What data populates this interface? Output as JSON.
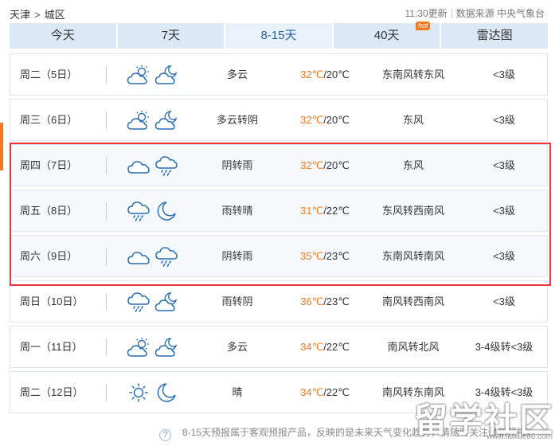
{
  "breadcrumb": {
    "city": "天津",
    "separator": ">",
    "district": "城区"
  },
  "meta": {
    "updated": "11:30更新",
    "source": "数据来源 中央气象台"
  },
  "tabs": [
    {
      "label": "今天"
    },
    {
      "label": "7天"
    },
    {
      "label": "8-15天",
      "active": true
    },
    {
      "label": "40天",
      "badge": "hot"
    },
    {
      "label": "雷达图"
    }
  ],
  "colors": {
    "accent": "#f47920",
    "tab_bg": "#dbe9f7",
    "highlight_border": "#e5373c",
    "icon": "#2a6fb0"
  },
  "days": [
    {
      "day": "周二（5日）",
      "icon_day": "partly-cloudy-day-icon",
      "icon_night": "partly-cloudy-night-icon",
      "desc": "多云",
      "high": "32℃",
      "low": "/20℃",
      "wind": "东南风转东风",
      "level": "<3级"
    },
    {
      "day": "周三（6日）",
      "icon_day": "partly-cloudy-day-icon",
      "icon_night": "partly-cloudy-night-icon",
      "desc": "多云转阴",
      "high": "32℃",
      "low": "/20℃",
      "wind": "东风",
      "level": "<3级"
    },
    {
      "day": "周四（7日）",
      "icon_day": "cloud-icon",
      "icon_night": "rain-icon",
      "desc": "阴转雨",
      "high": "32℃",
      "low": "/20℃",
      "wind": "东风",
      "level": "<3级"
    },
    {
      "day": "周五（8日）",
      "icon_day": "rain-icon",
      "icon_night": "moon-icon",
      "desc": "雨转晴",
      "high": "31℃",
      "low": "/22℃",
      "wind": "东风转西南风",
      "level": "<3级"
    },
    {
      "day": "周六（9日）",
      "icon_day": "cloud-icon",
      "icon_night": "rain-icon",
      "desc": "阴转雨",
      "high": "35℃",
      "low": "/23℃",
      "wind": "东南风转南风",
      "level": "<3级"
    },
    {
      "day": "周日（10日）",
      "icon_day": "rain-icon",
      "icon_night": "partly-cloudy-night-icon",
      "desc": "雨转阴",
      "high": "36℃",
      "low": "/23℃",
      "wind": "南风转西南风",
      "level": "<3级"
    },
    {
      "day": "周一（11日）",
      "icon_day": "partly-cloudy-day-icon",
      "icon_night": "partly-cloudy-night-icon",
      "desc": "多云",
      "high": "34℃",
      "low": "/22℃",
      "wind": "南风转北风",
      "level": "3-4级转<3级"
    },
    {
      "day": "周二（12日）",
      "icon_day": "sun-icon",
      "icon_night": "moon-icon",
      "desc": "晴",
      "high": "34℃",
      "low": "/22℃",
      "wind": "南风转东南风",
      "level": "3-4级转<3级"
    }
  ],
  "footnote": {
    "qmark": "?",
    "text": "8-15天预报属于客观预报产品，反映的是未来天气变化趋势，请随时关注最新预报。"
  },
  "watermark": {
    "text": "留学社区",
    "url": "www.liuxue86.com"
  }
}
